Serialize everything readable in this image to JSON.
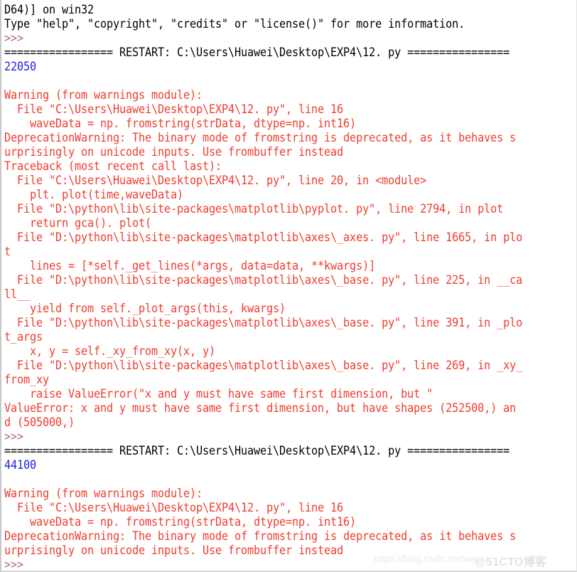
{
  "window": {
    "app": "Python IDLE Shell",
    "colors": {
      "background": "#ffffff",
      "normal_text": "#000000",
      "error_text": "#f03c2e",
      "output_text": "#2222dd",
      "prompt_text": "#b06a6a",
      "border": "#c8c8c8",
      "watermark": "#e9e9e9"
    }
  },
  "watermark": {
    "url": "https://blog.csdn.net/wei",
    "brand": "@51CTO博客"
  },
  "console": {
    "lines": [
      {
        "text": "D64)] on win32",
        "style": "c-black"
      },
      {
        "text": "Type \"help\", \"copyright\", \"credits\" or \"license()\" for more information.",
        "style": "c-black"
      },
      {
        "text": ">>>",
        "style": "c-prompt"
      },
      {
        "text": "================= RESTART: C:\\Users\\Huawei\\Desktop\\EXP4\\12. py ================",
        "style": "c-black"
      },
      {
        "text": "22050",
        "style": "c-blue"
      },
      {
        "text": "",
        "style": "c-black"
      },
      {
        "text": "Warning (from warnings module):",
        "style": "c-red"
      },
      {
        "text": "  File \"C:\\Users\\Huawei\\Desktop\\EXP4\\12. py\", line 16",
        "style": "c-red"
      },
      {
        "text": "    waveData = np. fromstring(strData, dtype=np. int16)",
        "style": "c-red"
      },
      {
        "text": "DeprecationWarning: The binary mode of fromstring is deprecated, as it behaves s",
        "style": "c-red"
      },
      {
        "text": "urprisingly on unicode inputs. Use frombuffer instead",
        "style": "c-red"
      },
      {
        "text": "Traceback (most recent call last):",
        "style": "c-red"
      },
      {
        "text": "  File \"C:\\Users\\Huawei\\Desktop\\EXP4\\12. py\", line 20, in <module>",
        "style": "c-red"
      },
      {
        "text": "    plt. plot(time,waveData)",
        "style": "c-red"
      },
      {
        "text": "  File \"D:\\python\\lib\\site-packages\\matplotlib\\pyplot. py\", line 2794, in plot",
        "style": "c-red"
      },
      {
        "text": "    return gca(). plot(",
        "style": "c-red"
      },
      {
        "text": "  File \"D:\\python\\lib\\site-packages\\matplotlib\\axes\\_axes. py\", line 1665, in plo",
        "style": "c-red"
      },
      {
        "text": "t",
        "style": "c-red"
      },
      {
        "text": "    lines = [*self._get_lines(*args, data=data, **kwargs)]",
        "style": "c-red"
      },
      {
        "text": "  File \"D:\\python\\lib\\site-packages\\matplotlib\\axes\\_base. py\", line 225, in __ca",
        "style": "c-red"
      },
      {
        "text": "ll__",
        "style": "c-red"
      },
      {
        "text": "    yield from self._plot_args(this, kwargs)",
        "style": "c-red"
      },
      {
        "text": "  File \"D:\\python\\lib\\site-packages\\matplotlib\\axes\\_base. py\", line 391, in _plo",
        "style": "c-red"
      },
      {
        "text": "t_args",
        "style": "c-red"
      },
      {
        "text": "    x, y = self._xy_from_xy(x, y)",
        "style": "c-red"
      },
      {
        "text": "  File \"D:\\python\\lib\\site-packages\\matplotlib\\axes\\_base. py\", line 269, in _xy_",
        "style": "c-red"
      },
      {
        "text": "from_xy",
        "style": "c-red"
      },
      {
        "text": "    raise ValueError(\"x and y must have same first dimension, but \"",
        "style": "c-red"
      },
      {
        "text": "ValueError: x and y must have same first dimension, but have shapes (252500,) an",
        "style": "c-red"
      },
      {
        "text": "d (505000,)",
        "style": "c-red"
      },
      {
        "text": ">>>",
        "style": "c-prompt"
      },
      {
        "text": "================= RESTART: C:\\Users\\Huawei\\Desktop\\EXP4\\12. py ================",
        "style": "c-black"
      },
      {
        "text": "44100",
        "style": "c-blue"
      },
      {
        "text": "",
        "style": "c-black"
      },
      {
        "text": "Warning (from warnings module):",
        "style": "c-red"
      },
      {
        "text": "  File \"C:\\Users\\Huawei\\Desktop\\EXP4\\12. py\", line 16",
        "style": "c-red"
      },
      {
        "text": "    waveData = np. fromstring(strData, dtype=np. int16)",
        "style": "c-red"
      },
      {
        "text": "DeprecationWarning: The binary mode of fromstring is deprecated, as it behaves s",
        "style": "c-red"
      },
      {
        "text": "urprisingly on unicode inputs. Use frombuffer instead",
        "style": "c-red"
      },
      {
        "text": ">>>",
        "style": "c-prompt"
      }
    ]
  }
}
